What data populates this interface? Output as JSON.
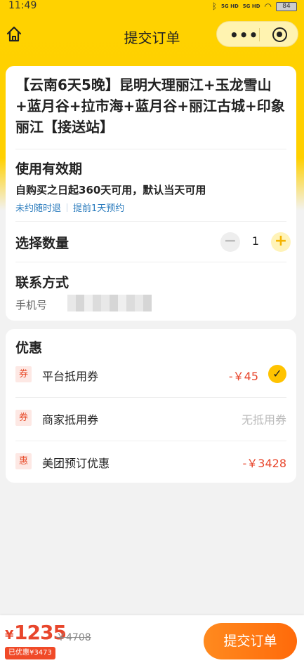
{
  "status_bar": {
    "time": "11:49",
    "signal1": "5G HD",
    "signal2": "5G HD",
    "battery": "84"
  },
  "navbar": {
    "title": "提交订单",
    "capsule_more": "•••"
  },
  "product": {
    "title": "【云南6天5晚】昆明大理丽江+玉龙雪山+蓝月谷+拉市海+蓝月谷+丽江古城+印象丽江【接送站】"
  },
  "validity": {
    "heading": "使用有效期",
    "text": "自购买之日起360天可用，默认当天可用",
    "tags": [
      "未约随时退",
      "提前1天预约"
    ]
  },
  "quantity": {
    "heading": "选择数量",
    "minus": "−",
    "value": "1",
    "plus": "+"
  },
  "contact": {
    "heading": "联系方式",
    "phone_label": "手机号"
  },
  "benefits": {
    "heading": "优惠",
    "items": [
      {
        "badge": "券",
        "label": "平台抵用券",
        "amount": "-￥45",
        "checked": true
      },
      {
        "badge": "券",
        "label": "商家抵用券",
        "amount": "无抵用券",
        "checked": false
      },
      {
        "badge": "惠",
        "label": "美团预订优惠",
        "amount": "-￥3428",
        "checked": false
      }
    ]
  },
  "footer": {
    "currency": "¥",
    "price": "1235",
    "original_price": "￥4708",
    "discount_badge": "已优惠¥3473",
    "submit": "提交订单"
  },
  "colors": {
    "brand_yellow": "#ffd200",
    "price_red": "#e8462c",
    "submit_orange": "#ff7a12",
    "link_blue": "#2a7bbd"
  }
}
